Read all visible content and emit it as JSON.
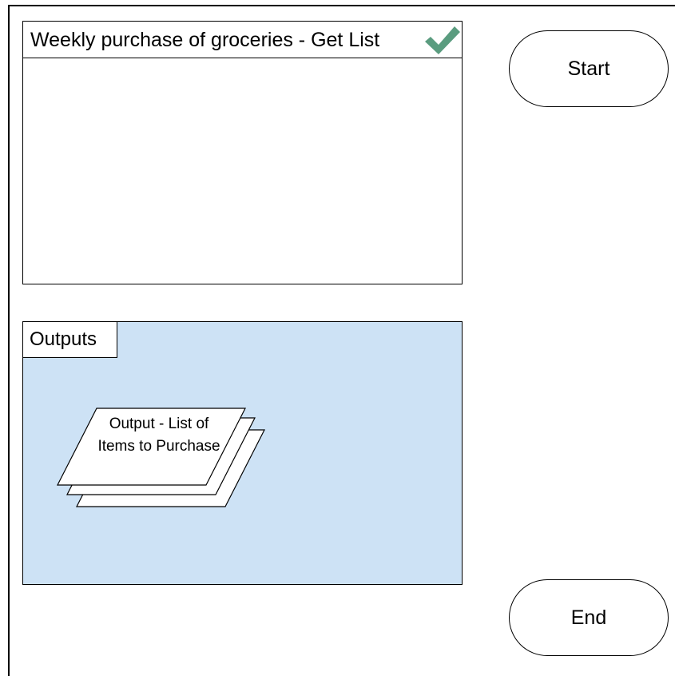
{
  "process": {
    "title": "Weekly purchase of groceries - Get List",
    "status_icon": "checkmark-icon",
    "status_color": "#5a9c7f"
  },
  "outputs": {
    "label": "Outputs",
    "background_color": "#cde2f5",
    "document": {
      "label": "Output - List of Items to Purchase",
      "icon": "multi-document-icon"
    }
  },
  "terminals": {
    "start_label": "Start",
    "end_label": "End"
  }
}
